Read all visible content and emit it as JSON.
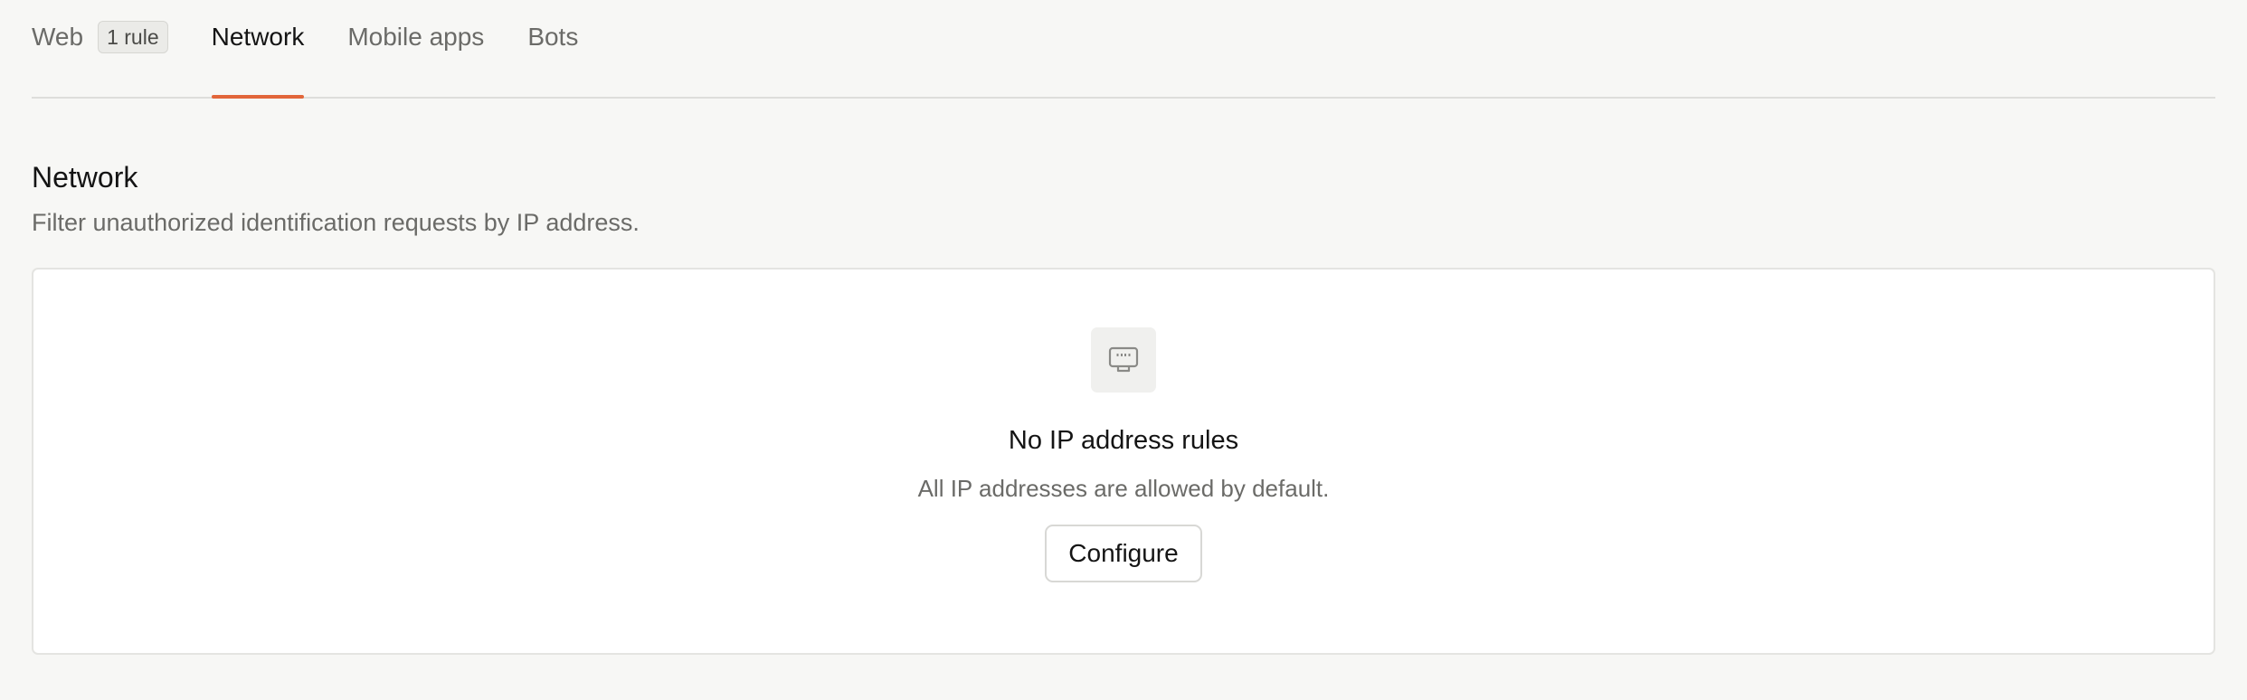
{
  "tabs": [
    {
      "label": "Web",
      "badge": "1 rule",
      "active": false
    },
    {
      "label": "Network",
      "active": true
    },
    {
      "label": "Mobile apps",
      "active": false
    },
    {
      "label": "Bots",
      "active": false
    }
  ],
  "section": {
    "title": "Network",
    "description": "Filter unauthorized identification requests by IP address."
  },
  "empty_state": {
    "icon": "ethernet-port-icon",
    "title": "No IP address rules",
    "description": "All IP addresses are allowed by default.",
    "button_label": "Configure"
  },
  "colors": {
    "accent": "#e2663a",
    "background": "#f7f7f5",
    "card": "#ffffff",
    "muted_text": "#6b6b68"
  }
}
